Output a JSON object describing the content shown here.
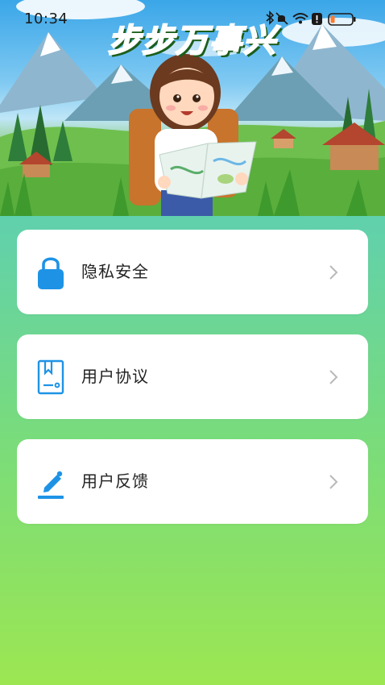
{
  "status_bar": {
    "time": "10:34",
    "icons": [
      "bluetooth-icon",
      "mute-icon",
      "wifi-icon",
      "alert-icon",
      "battery-low-icon"
    ]
  },
  "header": {
    "title": "步步万事兴"
  },
  "menu": {
    "items": [
      {
        "label": "隐私安全",
        "icon": "lock-icon"
      },
      {
        "label": "用户协议",
        "icon": "agreement-document-icon"
      },
      {
        "label": "用户反馈",
        "icon": "edit-pen-icon"
      }
    ]
  },
  "colors": {
    "icon_blue": "#1e93e6",
    "gradient_top": "#4cc6c7",
    "gradient_bottom": "#9ce652",
    "title_green": "#2f9b2f"
  }
}
